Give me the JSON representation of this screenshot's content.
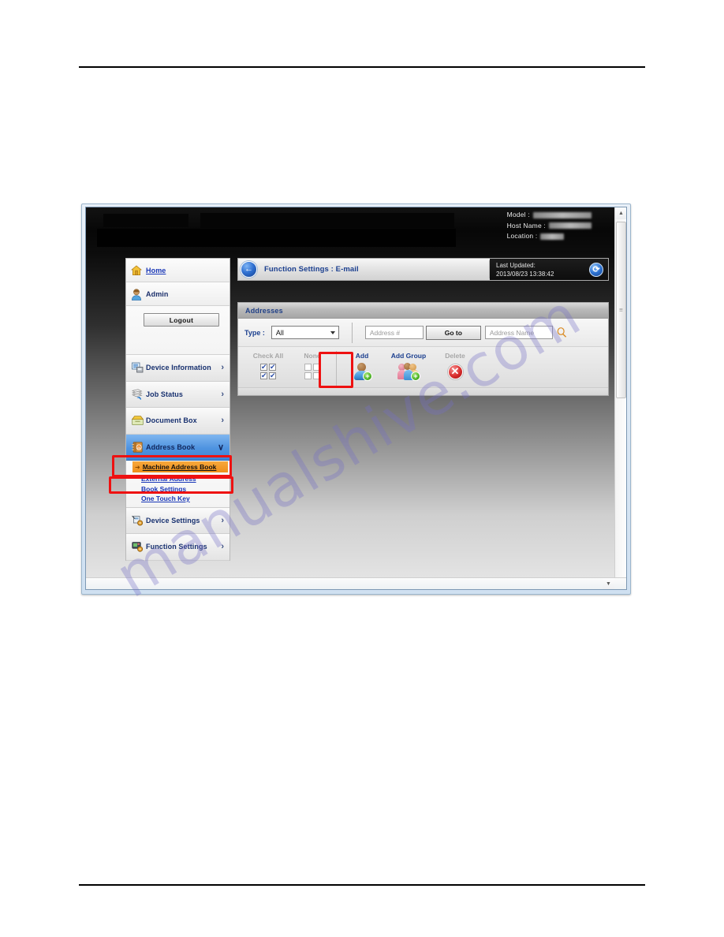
{
  "document": {
    "rules": [
      "top-rule",
      "bottom-rule"
    ],
    "watermark": "manualshive.com"
  },
  "device_header": {
    "model_label": "Model :",
    "host_label": "Host Name :",
    "location_label": "Location :",
    "model_value": "",
    "host_value": "",
    "location_value": ""
  },
  "sidebar": {
    "home": {
      "label": "Home",
      "icon": "home-icon"
    },
    "user": {
      "label": "Admin",
      "icon": "user-avatar-icon"
    },
    "logout": {
      "label": "Logout"
    },
    "nav": [
      {
        "label": "Device Information",
        "icon": "device-information-icon",
        "chevron": "›",
        "active": false
      },
      {
        "label": "Job Status",
        "icon": "job-status-icon",
        "chevron": "›",
        "active": false
      },
      {
        "label": "Document Box",
        "icon": "document-box-icon",
        "chevron": "›",
        "active": false
      },
      {
        "label": "Address Book",
        "icon": "address-book-icon",
        "chevron": "∨",
        "active": true
      },
      {
        "label": "Device Settings",
        "icon": "device-settings-icon",
        "chevron": "›",
        "active": false
      },
      {
        "label": "Function Settings",
        "icon": "function-settings-icon",
        "chevron": "›",
        "active": false
      }
    ],
    "sublinks": {
      "selected": "Machine Address Book",
      "items": [
        "External Address ",
        "Book Settings",
        "One Touch Key"
      ]
    }
  },
  "content": {
    "breadcrumb": "Function Settings : E-mail",
    "back_icon": "back-arrow-icon",
    "last_updated_label": "Last Updated:",
    "last_updated_value": "2013/08/23 13:38:42",
    "refresh_icon": "refresh-icon",
    "panel_title": "Addresses",
    "filter": {
      "type_label": "Type :",
      "type_value": "All",
      "address_number_placeholder": "Address #",
      "goto_label": "Go to",
      "address_name_placeholder": "Address Name",
      "search_icon": "magnifier-icon"
    },
    "tools": [
      {
        "label": "Check All",
        "icon": "checkbox-all-icon",
        "state": "disabled"
      },
      {
        "label": "None",
        "icon": "checkbox-none-icon",
        "state": "disabled"
      },
      {
        "label": "Add",
        "icon": "add-contact-icon",
        "state": "enabled"
      },
      {
        "label": "Add Group",
        "icon": "add-group-icon",
        "state": "enabled"
      },
      {
        "label": "Delete",
        "icon": "delete-icon",
        "state": "disabled"
      }
    ]
  },
  "annotations": {
    "boxes": [
      {
        "name": "address-book-highlight",
        "target": "Address Book"
      },
      {
        "name": "machine-address-book-highlight",
        "target": "Machine Address Book"
      },
      {
        "name": "add-button-highlight",
        "target": "Add"
      }
    ],
    "color": "#ee1111"
  },
  "scrollbars": {
    "vertical_up": "▲",
    "vertical_down": "▼",
    "horizontal_left": "◀",
    "horizontal_right": "▶"
  },
  "colors": {
    "accent_blue": "#1b3f8f",
    "active_nav": "#4e93e0",
    "sub_selected": "#ef8f1a",
    "annotation_red": "#ee1111"
  }
}
